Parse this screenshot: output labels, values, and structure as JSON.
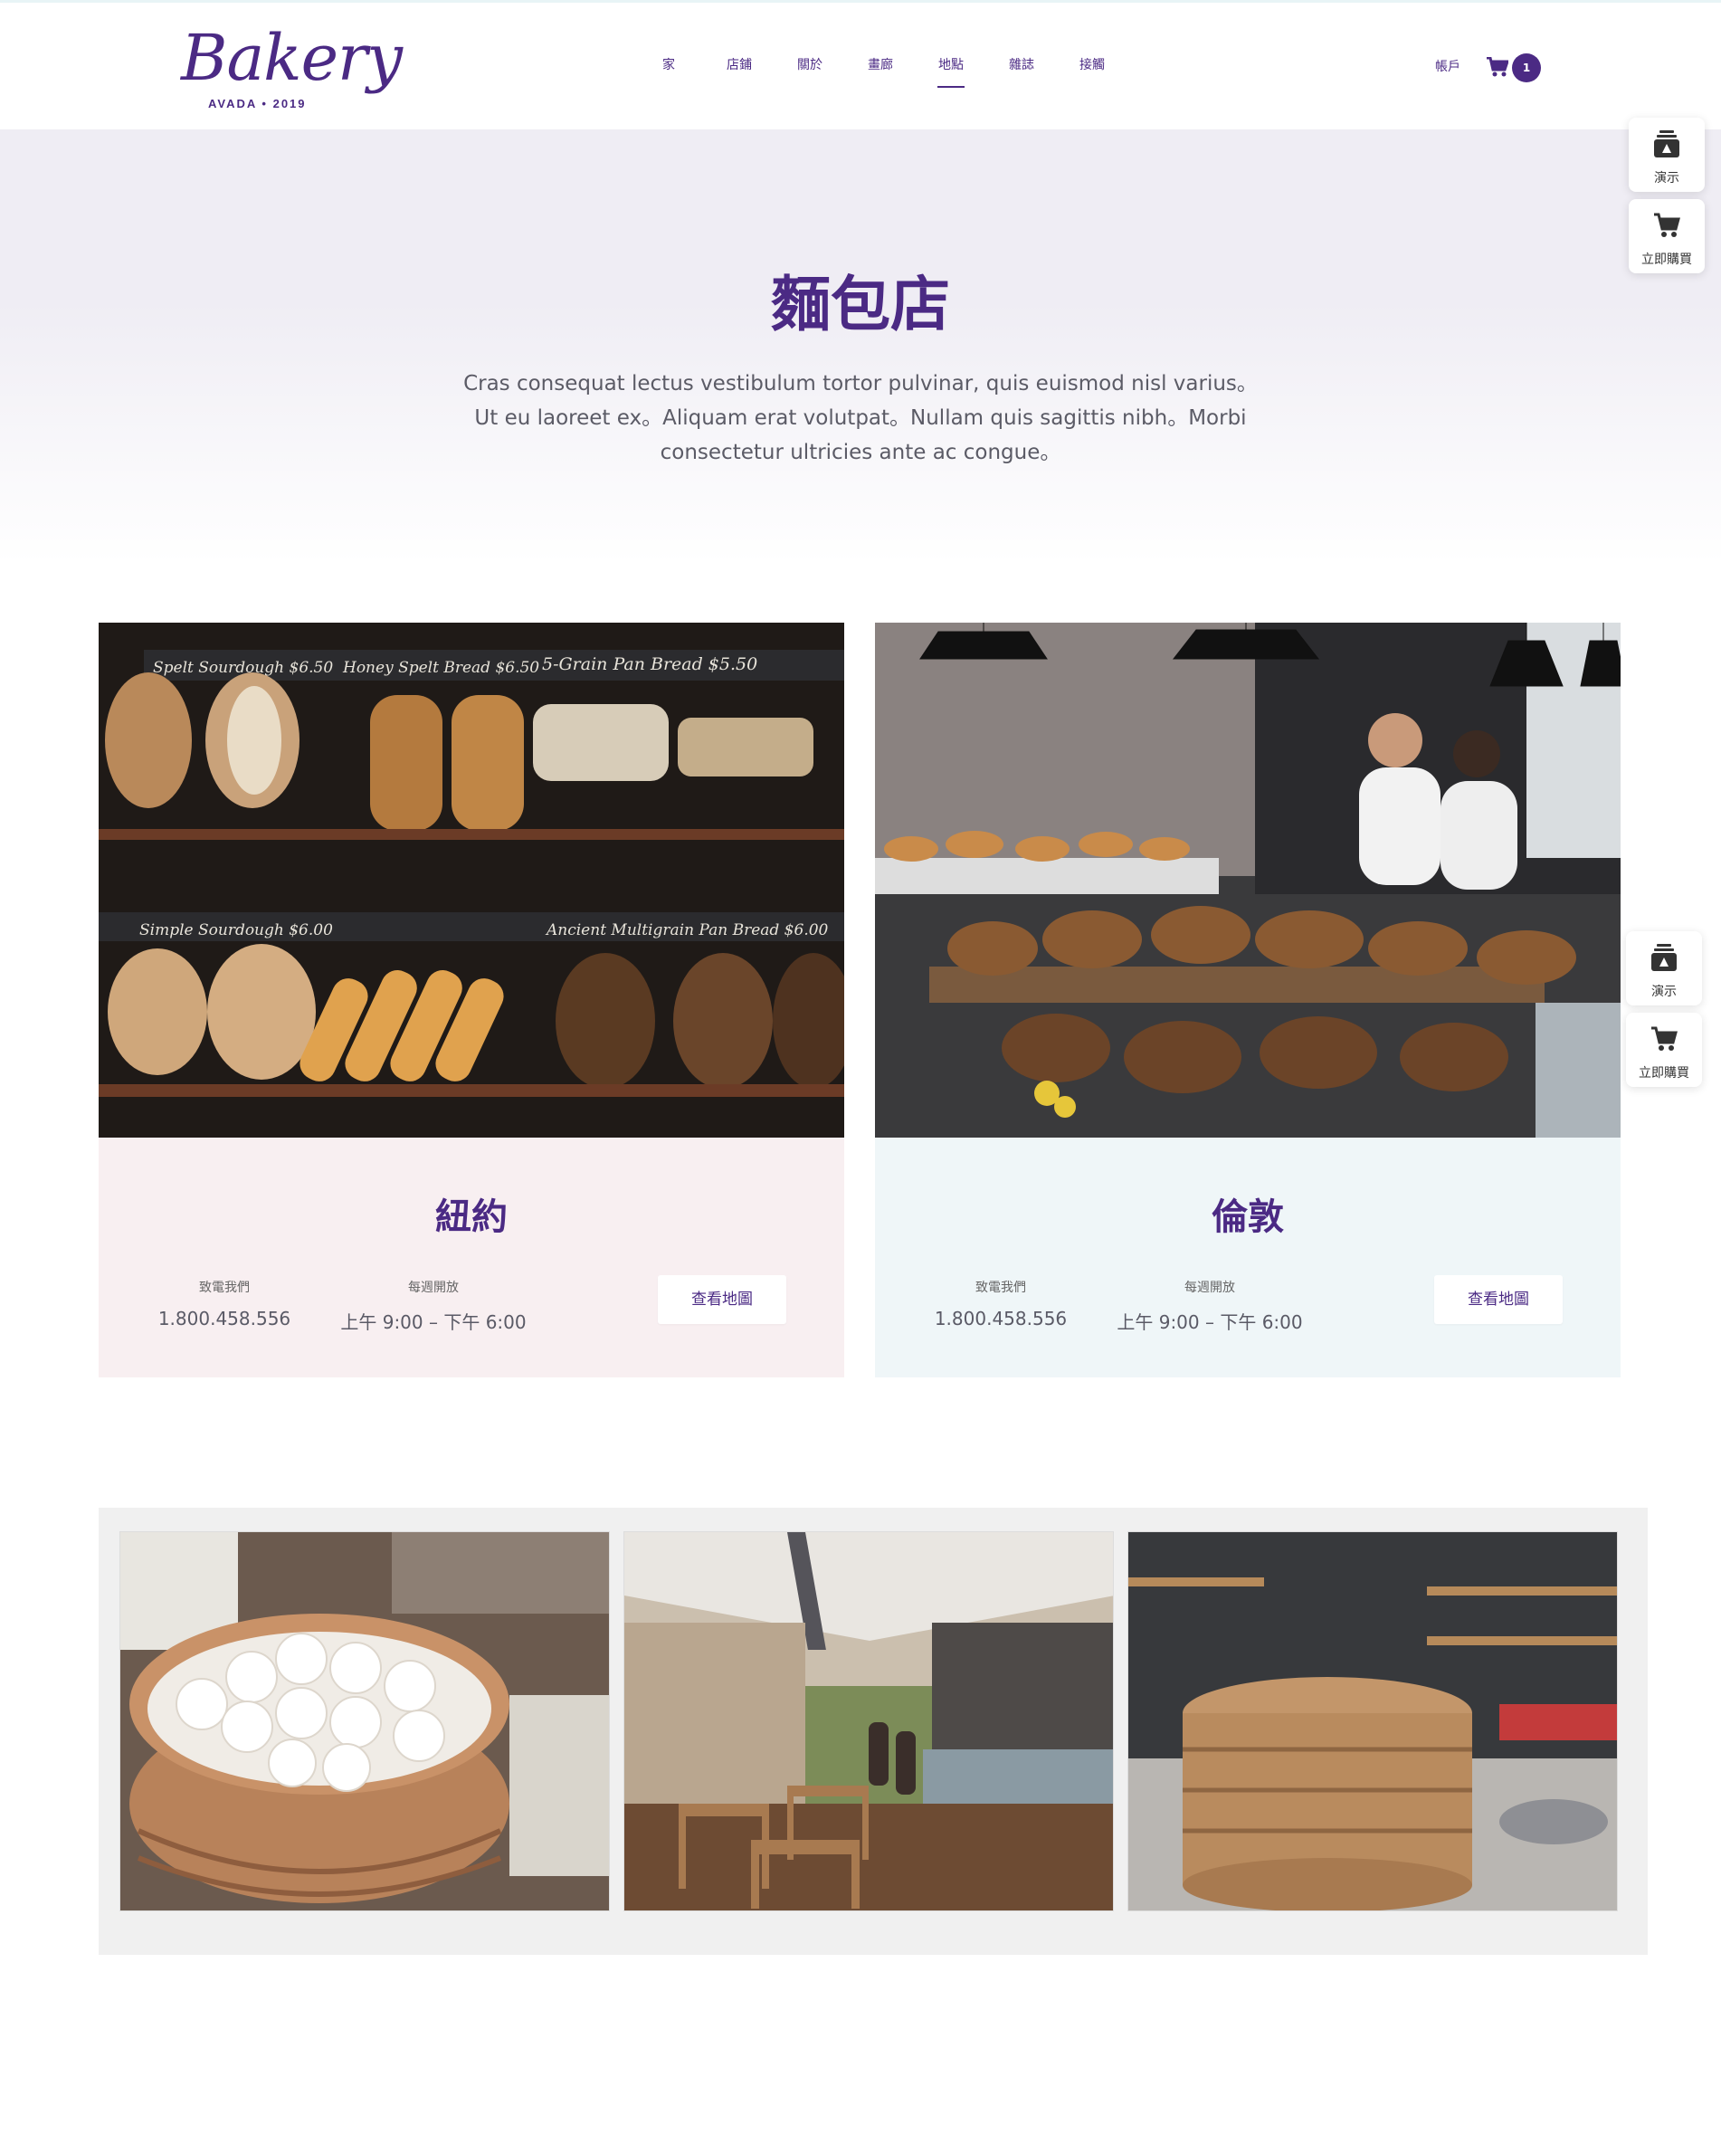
{
  "header": {
    "logo_text": "Bakery",
    "logo_sub": "AVADA • 2019",
    "nav": [
      {
        "label": "家",
        "active": false
      },
      {
        "label": "店鋪",
        "active": false
      },
      {
        "label": "關於",
        "active": false
      },
      {
        "label": "畫廊",
        "active": false
      },
      {
        "label": "地點",
        "active": true
      },
      {
        "label": "雜誌",
        "active": false
      },
      {
        "label": "接觸",
        "active": false
      }
    ],
    "account_label": "帳戶",
    "cart_count": "1"
  },
  "side_widgets": {
    "demo_label": "演示",
    "buy_label": "立即購買"
  },
  "hero": {
    "title": "麵包店",
    "text": "Cras consequat lectus vestibulum tortor pulvinar, quis euismod nisl varius。Ut eu laoreet ex。Aliquam erat volutpat。Nullam quis sagittis nibh。Morbi consectetur ultricies ante ac congue。"
  },
  "locations": [
    {
      "title": "紐約",
      "phone_label": "致電我們",
      "phone": "1.800.458.556",
      "hours_label": "每週開放",
      "hours": "上午 9:00 – 下午 6:00",
      "map_button": "查看地圖",
      "bg_color": "#f8eff1"
    },
    {
      "title": "倫敦",
      "phone_label": "致電我們",
      "phone": "1.800.458.556",
      "hours_label": "每週開放",
      "hours": "上午 9:00 – 下午 6:00",
      "map_button": "查看地圖",
      "bg_color": "#eff6f8"
    }
  ],
  "shelf_labels": {
    "top": [
      "Spelt Sourdough $6.50",
      "Honey Spelt Bread $6.50",
      "5-Grain Pan Bread $5.50"
    ],
    "bottom": [
      "Simple Sourdough $6.00",
      "Ancient Multigrain Pan Bread $6.00"
    ]
  },
  "colors": {
    "brand": "#4b2a84",
    "hero_bg": "#efedf4",
    "card_pink": "#f8eff1",
    "card_blue": "#eff6f8",
    "gallery_bg": "#f0f0f0"
  }
}
